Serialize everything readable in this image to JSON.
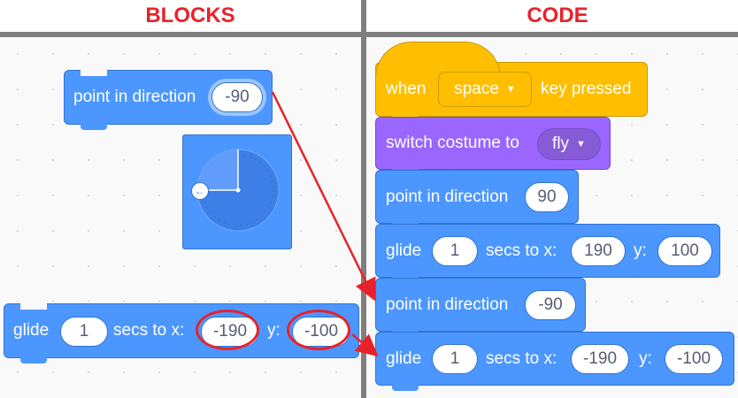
{
  "headings": {
    "left": "BLOCKS",
    "right": "CODE"
  },
  "blocks_palette": {
    "point_block": {
      "label": "point in direction",
      "value": "-90"
    },
    "glide_block": {
      "glide": "glide",
      "secs": "1",
      "secs_to_x": "secs to x:",
      "x": "-190",
      "y_label": "y:",
      "y": "-100"
    }
  },
  "code": {
    "hat": {
      "when": "when",
      "key": "space",
      "rest": "key pressed"
    },
    "costume": {
      "label": "switch costume to",
      "value": "fly"
    },
    "point1": {
      "label": "point in direction",
      "value": "90"
    },
    "glide1": {
      "glide": "glide",
      "secs": "1",
      "secs_to_x": "secs to x:",
      "x": "190",
      "y_label": "y:",
      "y": "100"
    },
    "point2": {
      "label": "point in direction",
      "value": "-90"
    },
    "glide2": {
      "glide": "glide",
      "secs": "1",
      "secs_to_x": "secs to x:",
      "x": "-190",
      "y_label": "y:",
      "y": "-100"
    }
  },
  "colors": {
    "motion": "#4c97ff",
    "events": "#ffbf00",
    "looks": "#9966ff",
    "annotation": "#e8222a"
  }
}
